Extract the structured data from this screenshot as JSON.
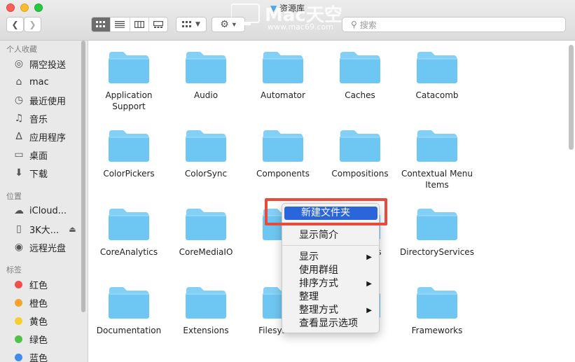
{
  "window": {
    "title": "资源库"
  },
  "toolbar": {
    "back_icon": "chevron-left-icon",
    "forward_icon": "chevron-right-icon",
    "view_modes": [
      "icon-view",
      "list-view",
      "column-view",
      "gallery-view"
    ],
    "active_view": "icon-view",
    "search_placeholder": "搜索"
  },
  "watermark": {
    "text": "Mac天空",
    "url": "www.mac69.com"
  },
  "sidebar": {
    "sections": [
      {
        "title": "个人收藏",
        "items": [
          {
            "label": "隔空投送",
            "icon": "airdrop-icon"
          },
          {
            "label": "mac",
            "icon": "home-icon"
          },
          {
            "label": "最近使用",
            "icon": "recents-icon"
          },
          {
            "label": "音乐",
            "icon": "music-icon"
          },
          {
            "label": "应用程序",
            "icon": "applications-icon"
          },
          {
            "label": "桌面",
            "icon": "desktop-icon"
          },
          {
            "label": "下载",
            "icon": "downloads-icon"
          }
        ]
      },
      {
        "title": "位置",
        "items": [
          {
            "label": "iCloud...",
            "icon": "cloud-icon"
          },
          {
            "label": "3K大...",
            "icon": "disk-icon"
          },
          {
            "label": "远程光盘",
            "icon": "optical-disc-icon"
          }
        ]
      },
      {
        "title": "标签",
        "items": [
          {
            "label": "红色",
            "color": "#f0504a"
          },
          {
            "label": "橙色",
            "color": "#f5a22f"
          },
          {
            "label": "黄色",
            "color": "#f4cf2f"
          },
          {
            "label": "绿色",
            "color": "#4fc24b"
          },
          {
            "label": "蓝色",
            "color": "#3f8cf0"
          }
        ]
      }
    ]
  },
  "folders": [
    "Application Support",
    "Audio",
    "Automator",
    "Caches",
    "Catacomb",
    "ColorPickers",
    "ColorSync",
    "Components",
    "Compositions",
    "Contextual Menu Items",
    "CoreAnalytics",
    "CoreMediaIO",
    "",
    "Assistants",
    "DirectoryServices",
    "Documentation",
    "Extensions",
    "Filesystems",
    "Fonts",
    "Frameworks"
  ],
  "context_menu": {
    "items": [
      {
        "label": "新建文件夹",
        "highlighted": true
      },
      {
        "label": "显示简介"
      },
      {
        "label": "显示",
        "submenu": true
      },
      {
        "label": "使用群组"
      },
      {
        "label": "排序方式",
        "submenu": true
      },
      {
        "label": "整理"
      },
      {
        "label": "整理方式",
        "submenu": true
      },
      {
        "label": "查看显示选项"
      }
    ],
    "submenu_arrow": "▶"
  },
  "colors": {
    "folder": "#6ec7f3",
    "highlight": "#2a66d9",
    "annotation": "#e84b3c"
  }
}
